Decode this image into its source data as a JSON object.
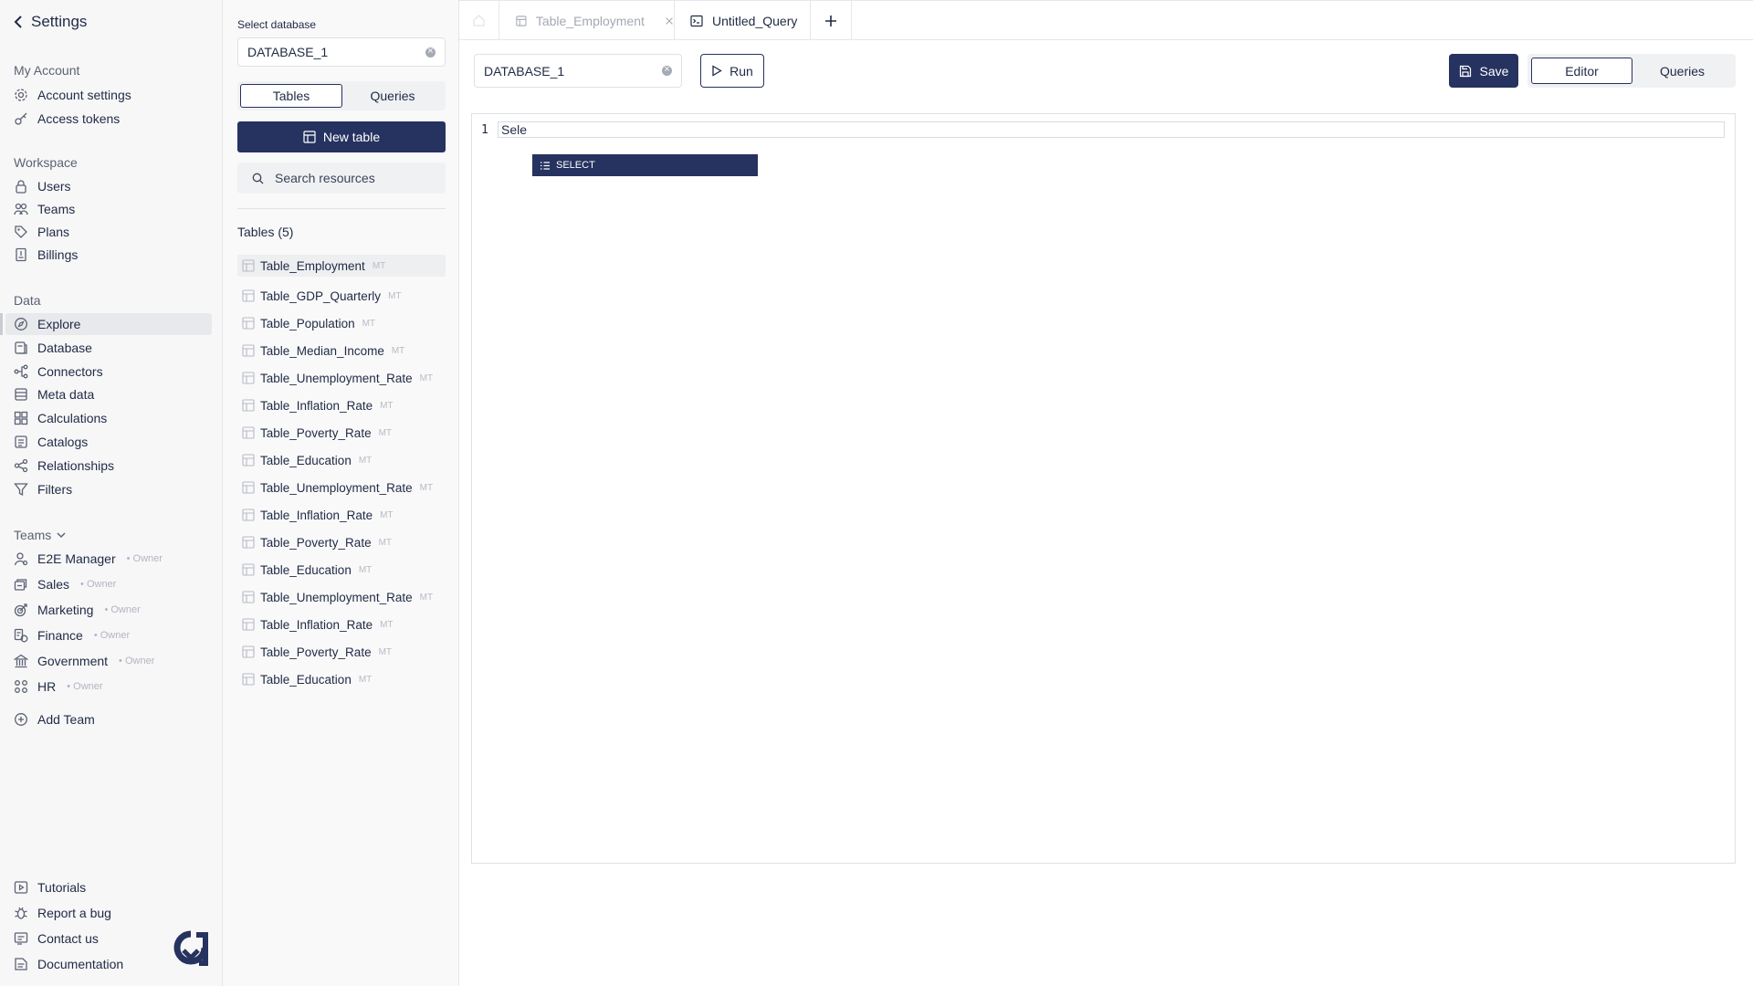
{
  "sidebar": {
    "back_label": "Settings",
    "sections": {
      "my_account": "My Account",
      "workspace": "Workspace",
      "data": "Data",
      "teams": "Teams"
    },
    "account_items": [
      {
        "label": "Account settings",
        "icon": "gear-icon"
      },
      {
        "label": "Access tokens",
        "icon": "key-icon"
      }
    ],
    "workspace_items": [
      {
        "label": "Users",
        "icon": "lock-icon"
      },
      {
        "label": "Teams",
        "icon": "teams-icon"
      },
      {
        "label": "Plans",
        "icon": "tag-icon"
      },
      {
        "label": "Billings",
        "icon": "billing-icon"
      }
    ],
    "data_items": [
      {
        "label": "Explore",
        "icon": "compass-icon",
        "active": true
      },
      {
        "label": "Database",
        "icon": "database-icon"
      },
      {
        "label": "Connectors",
        "icon": "connectors-icon"
      },
      {
        "label": "Meta data",
        "icon": "metadata-icon"
      },
      {
        "label": "Calculations",
        "icon": "calculations-icon"
      },
      {
        "label": "Catalogs",
        "icon": "catalog-icon"
      },
      {
        "label": "Relationships",
        "icon": "share-icon"
      },
      {
        "label": "Filters",
        "icon": "filter-icon"
      }
    ],
    "team_items": [
      {
        "label": "E2E Manager",
        "role": "• Owner",
        "icon": "user-icon"
      },
      {
        "label": "Sales",
        "role": "• Owner",
        "icon": "sales-icon"
      },
      {
        "label": "Marketing",
        "role": "• Owner",
        "icon": "target-icon"
      },
      {
        "label": "Finance",
        "role": "• Owner",
        "icon": "finance-icon"
      },
      {
        "label": "Government",
        "role": "• Owner",
        "icon": "bank-icon"
      },
      {
        "label": "HR",
        "role": "• Owner",
        "icon": "hr-icon"
      }
    ],
    "add_team": "Add Team",
    "footer_items": [
      {
        "label": "Tutorials",
        "icon": "video-icon"
      },
      {
        "label": "Report a bug",
        "icon": "bug-icon"
      },
      {
        "label": "Contact us",
        "icon": "contact-icon"
      },
      {
        "label": "Documentation",
        "icon": "docs-icon"
      }
    ]
  },
  "panel": {
    "select_label": "Select database",
    "database_value": "DATABASE_1",
    "tabs": [
      "Tables",
      "Queries"
    ],
    "active_tab": "Tables",
    "new_table_label": "New table",
    "search_placeholder": "Search resources",
    "tables_count": "Tables (5)",
    "badge": "MT",
    "tables": [
      "Table_Employment",
      "Table_GDP_Quarterly",
      "Table_Population",
      "Table_Median_Income",
      "Table_Unemployment_Rate",
      "Table_Inflation_Rate",
      "Table_Poverty_Rate",
      "Table_Education",
      "Table_Unemployment_Rate",
      "Table_Inflation_Rate",
      "Table_Poverty_Rate",
      "Table_Education",
      "Table_Unemployment_Rate",
      "Table_Inflation_Rate",
      "Table_Poverty_Rate",
      "Table_Education"
    ]
  },
  "tabs": {
    "employment": "Table_Employment",
    "query": "Untitled_Query"
  },
  "editor": {
    "database_value": "DATABASE_1",
    "run_label": "Run",
    "save_label": "Save",
    "view_options": [
      "Editor",
      "Queries"
    ],
    "active_view": "Editor",
    "line_number": "1",
    "code": "Sele",
    "suggestion": "SELECT"
  },
  "colors": {
    "primary": "#26325f",
    "sidebar_bg": "#f7f7f8",
    "muted": "#b2b6c0"
  }
}
